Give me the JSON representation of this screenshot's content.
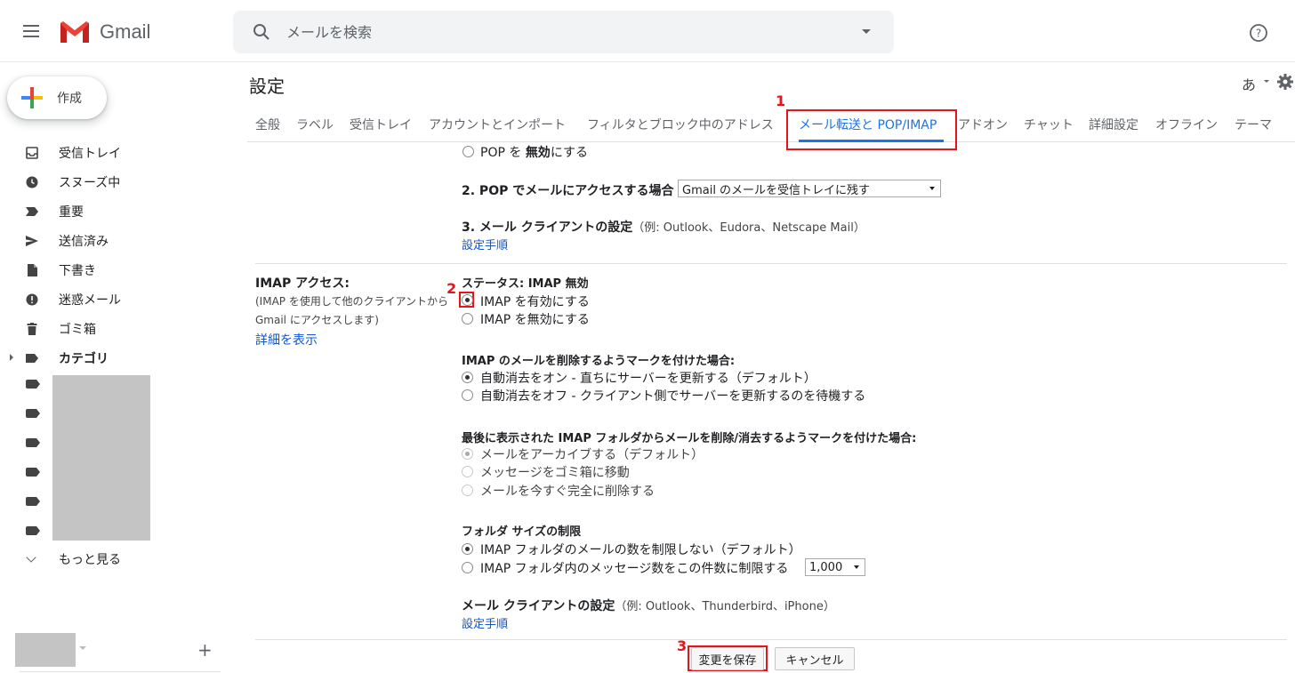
{
  "header": {
    "app_name": "Gmail",
    "search_placeholder": "メールを検索"
  },
  "sidebar": {
    "compose_label": "作成",
    "items": [
      {
        "label": "受信トレイ",
        "icon": "inbox-icon"
      },
      {
        "label": "スヌーズ中",
        "icon": "clock-icon"
      },
      {
        "label": "重要",
        "icon": "important-icon"
      },
      {
        "label": "送信済み",
        "icon": "send-icon"
      },
      {
        "label": "下書き",
        "icon": "draft-icon"
      },
      {
        "label": "迷惑メール",
        "icon": "spam-icon"
      },
      {
        "label": "ゴミ箱",
        "icon": "trash-icon"
      },
      {
        "label": "カテゴリ",
        "icon": "label-icon"
      }
    ],
    "more_label": "もっと見る",
    "add_label": "+"
  },
  "settings": {
    "title": "設定",
    "lang": "あ",
    "tabs": [
      "全般",
      "ラベル",
      "受信トレイ",
      "アカウントとインポート",
      "フィルタとブロック中のアドレス",
      "メール転送と POP/IMAP",
      "アドオン",
      "チャット",
      "詳細設定",
      "オフライン",
      "テーマ"
    ],
    "active_tab": "メール転送と POP/IMAP"
  },
  "pop": {
    "disable_pop_pre": "POP を",
    "disable_pop_bold": "無効",
    "disable_pop_post": "にする",
    "access_label": "2. POP でメールにアクセスする場合",
    "access_select": "Gmail のメールを受信トレイに残す",
    "client_label": "3. メール クライアントの設定",
    "client_hint": "（例: Outlook、Eudora、Netscape Mail）",
    "client_link": "設定手順"
  },
  "imap": {
    "section_title": "IMAP アクセス:",
    "section_desc_1": "(IMAP を使用して他のクライアントから",
    "section_desc_2": "Gmail にアクセスします)",
    "details_link": "詳細を表示",
    "status": "ステータス: IMAP 無効",
    "enable": "IMAP を有効にする",
    "disable": "IMAP を無効にする",
    "delete_mark_title": "IMAP のメールを削除するようマークを付けた場合:",
    "expunge_on": "自動消去をオン - 直ちにサーバーを更新する（デフォルト）",
    "expunge_off": "自動消去をオフ - クライアント側でサーバーを更新するのを待機する",
    "last_folder_title": "最後に表示された IMAP フォルダからメールを削除/消去するようマークを付けた場合:",
    "archive": "メールをアーカイブする（デフォルト）",
    "move_trash": "メッセージをゴミ箱に移動",
    "delete_forever": "メールを今すぐ完全に削除する",
    "folder_size_title": "フォルダ サイズの制限",
    "no_limit": "IMAP フォルダのメールの数を制限しない（デフォルト）",
    "limit": "IMAP フォルダ内のメッセージ数をこの件数に制限する",
    "limit_value": "1,000",
    "client_title": "メール クライアントの設定",
    "client_hint": "（例: Outlook、Thunderbird、iPhone）",
    "client_link": "設定手順"
  },
  "actions": {
    "save": "変更を保存",
    "cancel": "キャンセル"
  },
  "callouts": [
    "1",
    "2",
    "3"
  ],
  "colors": {
    "accent": "#1a73e8",
    "highlight": "#e5141c",
    "link": "#1155cc"
  }
}
